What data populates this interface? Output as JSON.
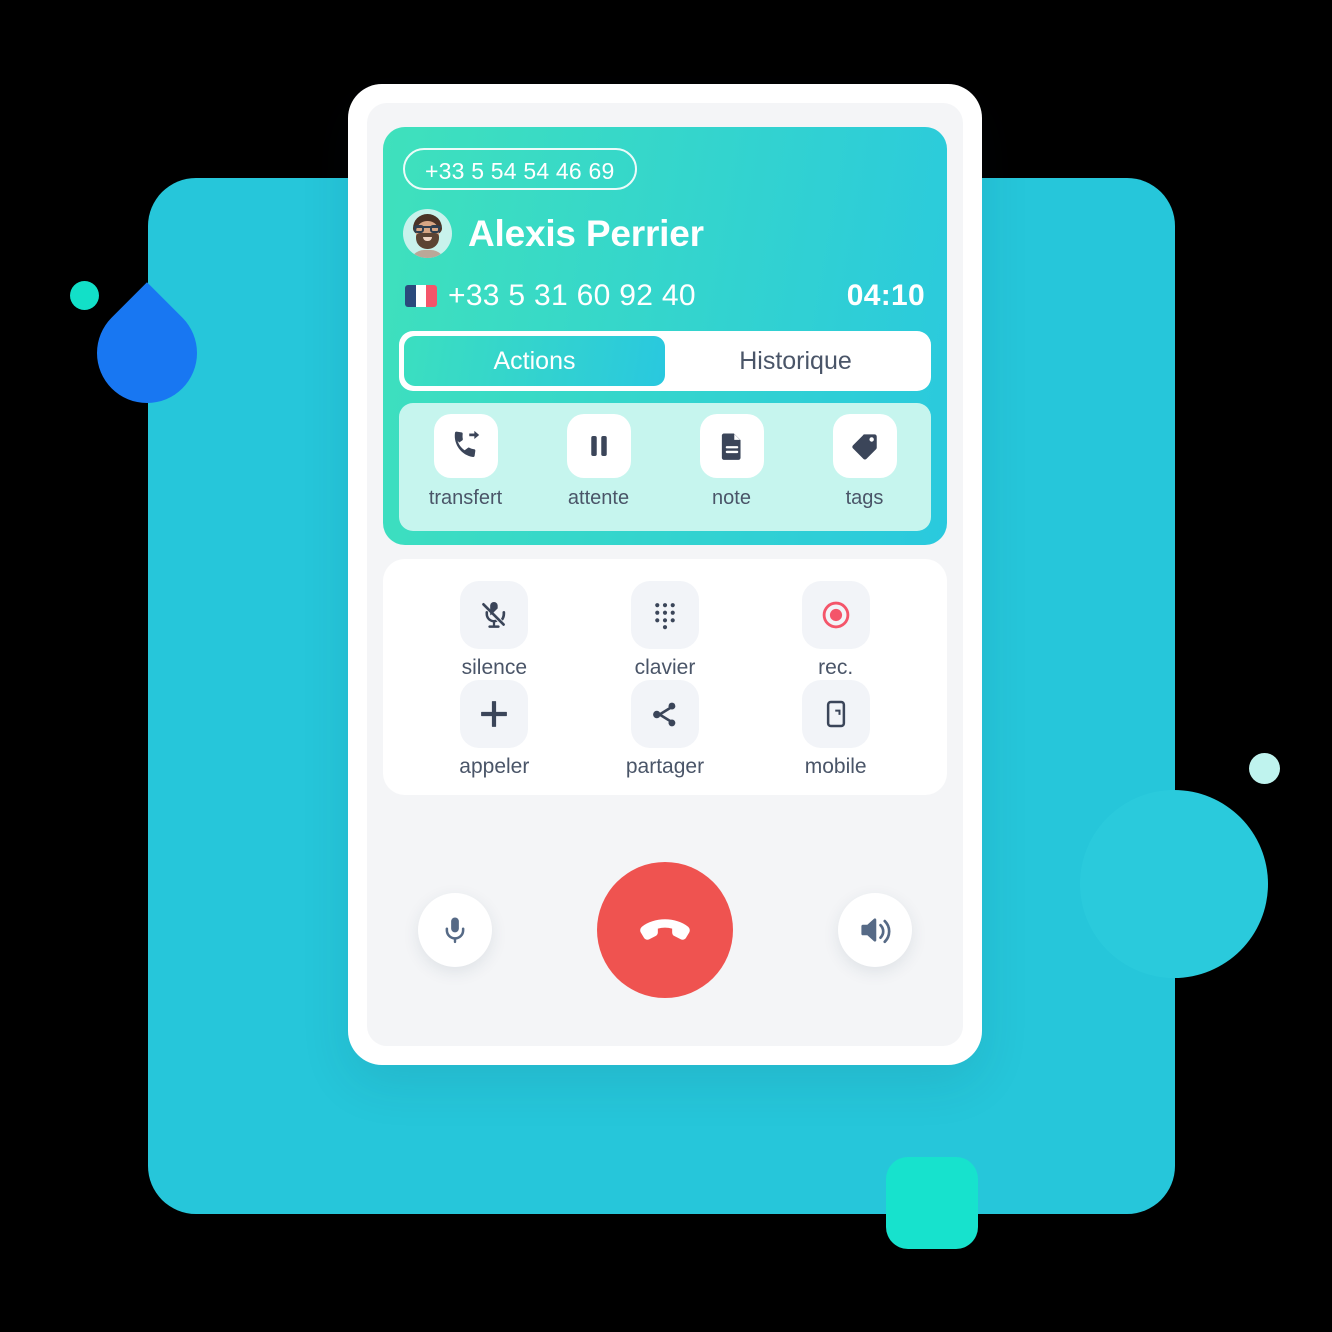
{
  "colors": {
    "backdrop": "#26C6DA",
    "header_gradient_start": "#3FE1BC",
    "header_gradient_end": "#2AC9DE",
    "accent_turquoise": "#17E2CD",
    "blue_leaf": "#1877F2",
    "hangup_red": "#EF5350",
    "record_red": "#F4556A",
    "screen_bg": "#F4F5F7",
    "actions_strip": "#C6F5EE",
    "text_dark": "#3B4559",
    "label_gray": "#4A5568"
  },
  "header": {
    "line_number": "+33 5 54 54 46 69",
    "contact_name": "Alexis Perrier",
    "avatar_icon": "avatar-photo-man-glasses",
    "country_flag": "flag-france",
    "caller_number": "+33 5 31 60 92 40",
    "call_timer": "04:10"
  },
  "tabs": [
    {
      "label": "Actions",
      "active": true
    },
    {
      "label": "Historique",
      "active": false
    }
  ],
  "actions": [
    {
      "label": "transfert",
      "icon": "phone-forward-icon"
    },
    {
      "label": "attente",
      "icon": "pause-icon"
    },
    {
      "label": "note",
      "icon": "document-note-icon"
    },
    {
      "label": "tags",
      "icon": "tag-icon"
    }
  ],
  "controls": [
    {
      "label": "silence",
      "icon": "microphone-muted-icon"
    },
    {
      "label": "clavier",
      "icon": "dialpad-icon"
    },
    {
      "label": "rec.",
      "icon": "record-icon"
    },
    {
      "label": "appeler",
      "icon": "plus-icon"
    },
    {
      "label": "partager",
      "icon": "share-icon"
    },
    {
      "label": "mobile",
      "icon": "mobile-transfer-icon"
    }
  ],
  "callbar": {
    "mic_icon": "microphone-icon",
    "hangup_icon": "phone-hangup-icon",
    "speaker_icon": "speaker-volume-icon"
  }
}
